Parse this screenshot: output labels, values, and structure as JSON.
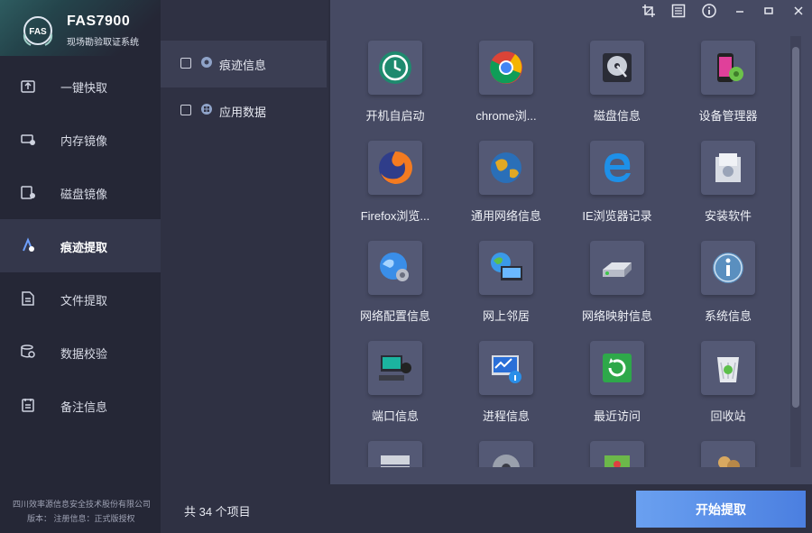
{
  "app": {
    "title": "FAS7900",
    "subtitle": "现场勘验取证系统",
    "logo_text": "FAS"
  },
  "sidebar": {
    "items": [
      {
        "label": "一键快取",
        "icon": "quick-extract-icon"
      },
      {
        "label": "内存镜像",
        "icon": "memory-image-icon"
      },
      {
        "label": "磁盘镜像",
        "icon": "disk-image-icon"
      },
      {
        "label": "痕迹提取",
        "icon": "trace-extract-icon",
        "active": true
      },
      {
        "label": "文件提取",
        "icon": "file-extract-icon"
      },
      {
        "label": "数据校验",
        "icon": "data-verify-icon"
      },
      {
        "label": "备注信息",
        "icon": "notes-icon"
      }
    ],
    "footer_company": "四川效率源信息安全技术股份有限公司",
    "footer_version": "版本：   注册信息：正式版授权"
  },
  "categories": [
    {
      "label": "痕迹信息",
      "checked": false,
      "active": true
    },
    {
      "label": "应用数据",
      "checked": false,
      "active": false
    }
  ],
  "tiles": [
    {
      "label": "开机自启动",
      "icon": "startup-clock-icon"
    },
    {
      "label": "chrome浏...",
      "icon": "chrome-icon"
    },
    {
      "label": "磁盘信息",
      "icon": "hard-disk-icon"
    },
    {
      "label": "设备管理器",
      "icon": "device-manager-icon"
    },
    {
      "label": "Firefox浏览...",
      "icon": "firefox-icon"
    },
    {
      "label": "通用网络信息",
      "icon": "globe-icon"
    },
    {
      "label": "IE浏览器记录",
      "icon": "ie-icon"
    },
    {
      "label": "安装软件",
      "icon": "install-software-icon"
    },
    {
      "label": "网络配置信息",
      "icon": "network-config-icon"
    },
    {
      "label": "网上邻居",
      "icon": "network-neighborhood-icon"
    },
    {
      "label": "网络映射信息",
      "icon": "network-drive-icon"
    },
    {
      "label": "系统信息",
      "icon": "info-icon"
    },
    {
      "label": "端口信息",
      "icon": "port-icon"
    },
    {
      "label": "进程信息",
      "icon": "process-icon"
    },
    {
      "label": "最近访问",
      "icon": "recent-access-icon"
    },
    {
      "label": "回收站",
      "icon": "recycle-bin-icon"
    },
    {
      "label": "",
      "icon": "server-icon"
    },
    {
      "label": "",
      "icon": "gear-disk-icon"
    },
    {
      "label": "",
      "icon": "map-icon"
    },
    {
      "label": "",
      "icon": "users-icon"
    }
  ],
  "status": {
    "count_text": "共 34 个项目"
  },
  "actions": {
    "start_label": "开始提取"
  },
  "colors": {
    "accent": "#5a8ee8",
    "sidebar_bg": "#252736",
    "main_bg": "#464a63"
  }
}
